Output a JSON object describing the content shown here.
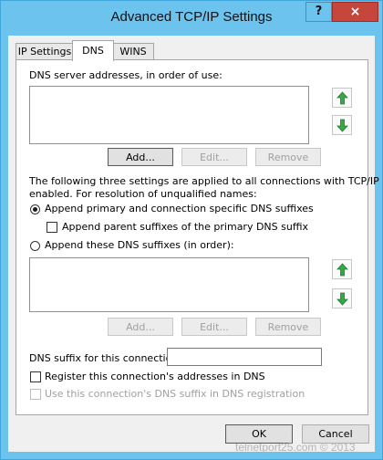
{
  "window": {
    "title": "Advanced TCP/IP Settings",
    "help_glyph": "?",
    "close_glyph": "×"
  },
  "tabs": [
    {
      "label": "IP Settings",
      "active": false
    },
    {
      "label": "DNS",
      "active": true
    },
    {
      "label": "WINS",
      "active": false
    }
  ],
  "dns": {
    "servers_label": "DNS server addresses, in order of use:",
    "servers": [],
    "server_buttons": {
      "add": "Add...",
      "edit": "Edit...",
      "remove": "Remove"
    },
    "description": [
      "The following three settings are applied to all connections with TCP/IP",
      "enabled. For resolution of unqualified names:"
    ],
    "radio_primary": {
      "label": "Append primary and connection specific DNS suffixes",
      "checked": true
    },
    "check_parent": {
      "label": "Append parent suffixes of the primary DNS suffix",
      "checked": false
    },
    "radio_these": {
      "label": "Append these DNS suffixes (in order):",
      "checked": false
    },
    "suffixes": [],
    "suffix_buttons": {
      "add": "Add...",
      "edit": "Edit...",
      "remove": "Remove"
    },
    "connection_suffix_label": "DNS suffix for this connection:",
    "connection_suffix_value": "",
    "register_label": "Register this connection's addresses in DNS",
    "use_suffix_label": "Use this connection's DNS suffix in DNS registration"
  },
  "footer": {
    "ok": "OK",
    "cancel": "Cancel"
  },
  "watermark": "telnetport25.com © 2013",
  "colors": {
    "titlebar": "#6cc3ee",
    "close": "#c7463c",
    "arrow_green": "#3aa64a"
  },
  "icons": [
    "help-icon",
    "close-icon",
    "arrow-up-icon",
    "arrow-down-icon"
  ]
}
